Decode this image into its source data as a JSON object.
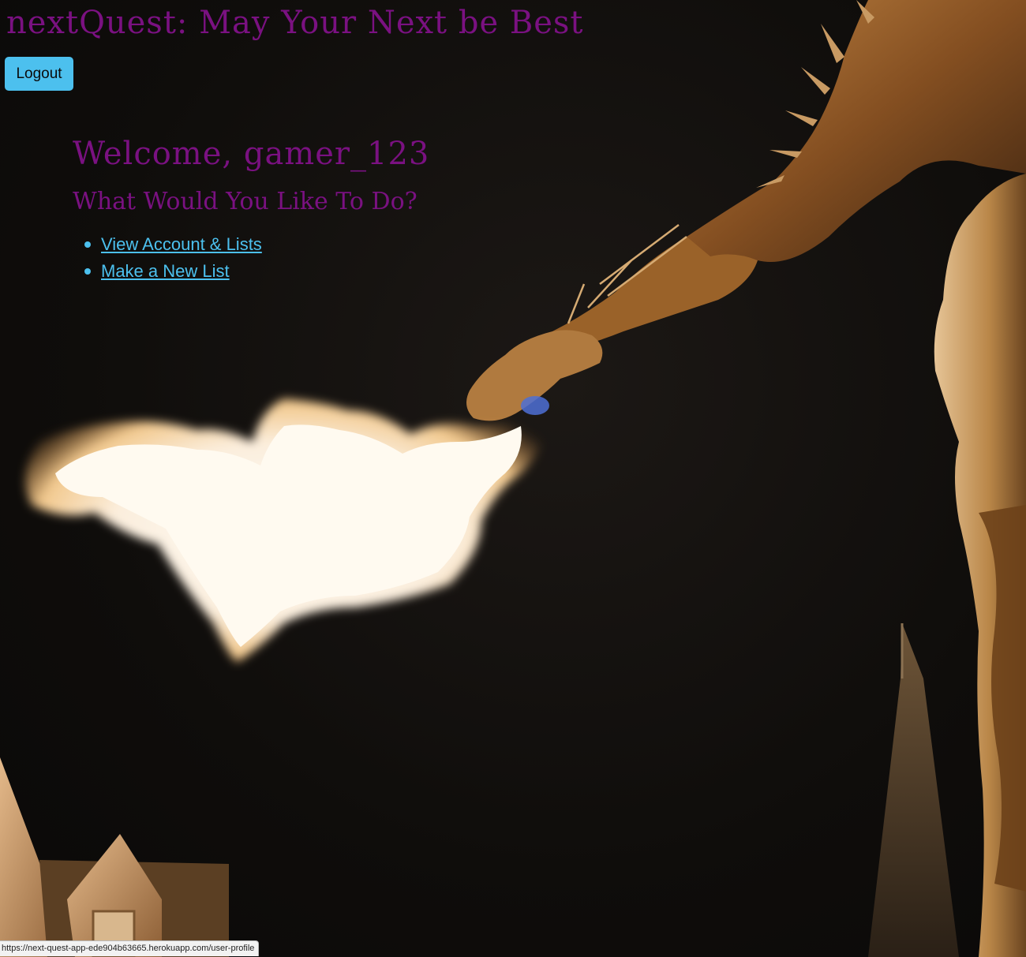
{
  "header": {
    "title": "nextQuest: May Your Next be Best",
    "logout_label": "Logout"
  },
  "main": {
    "welcome": "Welcome, gamer_123",
    "prompt": "What Would You Like To Do?",
    "links": [
      {
        "label": "View Account & Lists"
      },
      {
        "label": "Make a New List"
      }
    ]
  },
  "status_bar": {
    "url": "https://next-quest-app-ede904b63665.herokuapp.com/user-profile"
  },
  "colors": {
    "heading": "#7a1181",
    "accent": "#4cc0ee",
    "background": "#0e0d0c"
  },
  "background_image": {
    "icon": "dragon-breathing-fire-illustration"
  }
}
